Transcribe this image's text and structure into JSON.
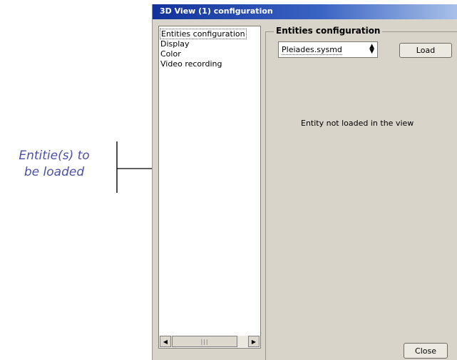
{
  "annotation": {
    "line1": "Entitie(s) to",
    "line2": "be loaded"
  },
  "window": {
    "title": "3D View (1) configuration"
  },
  "sidebar": {
    "items": [
      {
        "label": "Entities configuration",
        "selected": true
      },
      {
        "label": "Display"
      },
      {
        "label": "Color"
      },
      {
        "label": "Video recording"
      }
    ]
  },
  "panel": {
    "group_title": "Entities configuration",
    "combo_value": "Pleiades.sysmd",
    "load_label": "Load",
    "message": "Entity not loaded in the view"
  },
  "footer": {
    "close_label": "Close"
  },
  "colors": {
    "annotation": "#4a4fa8",
    "titlebar": "#12329a",
    "window_bg": "#d8d4c9"
  }
}
